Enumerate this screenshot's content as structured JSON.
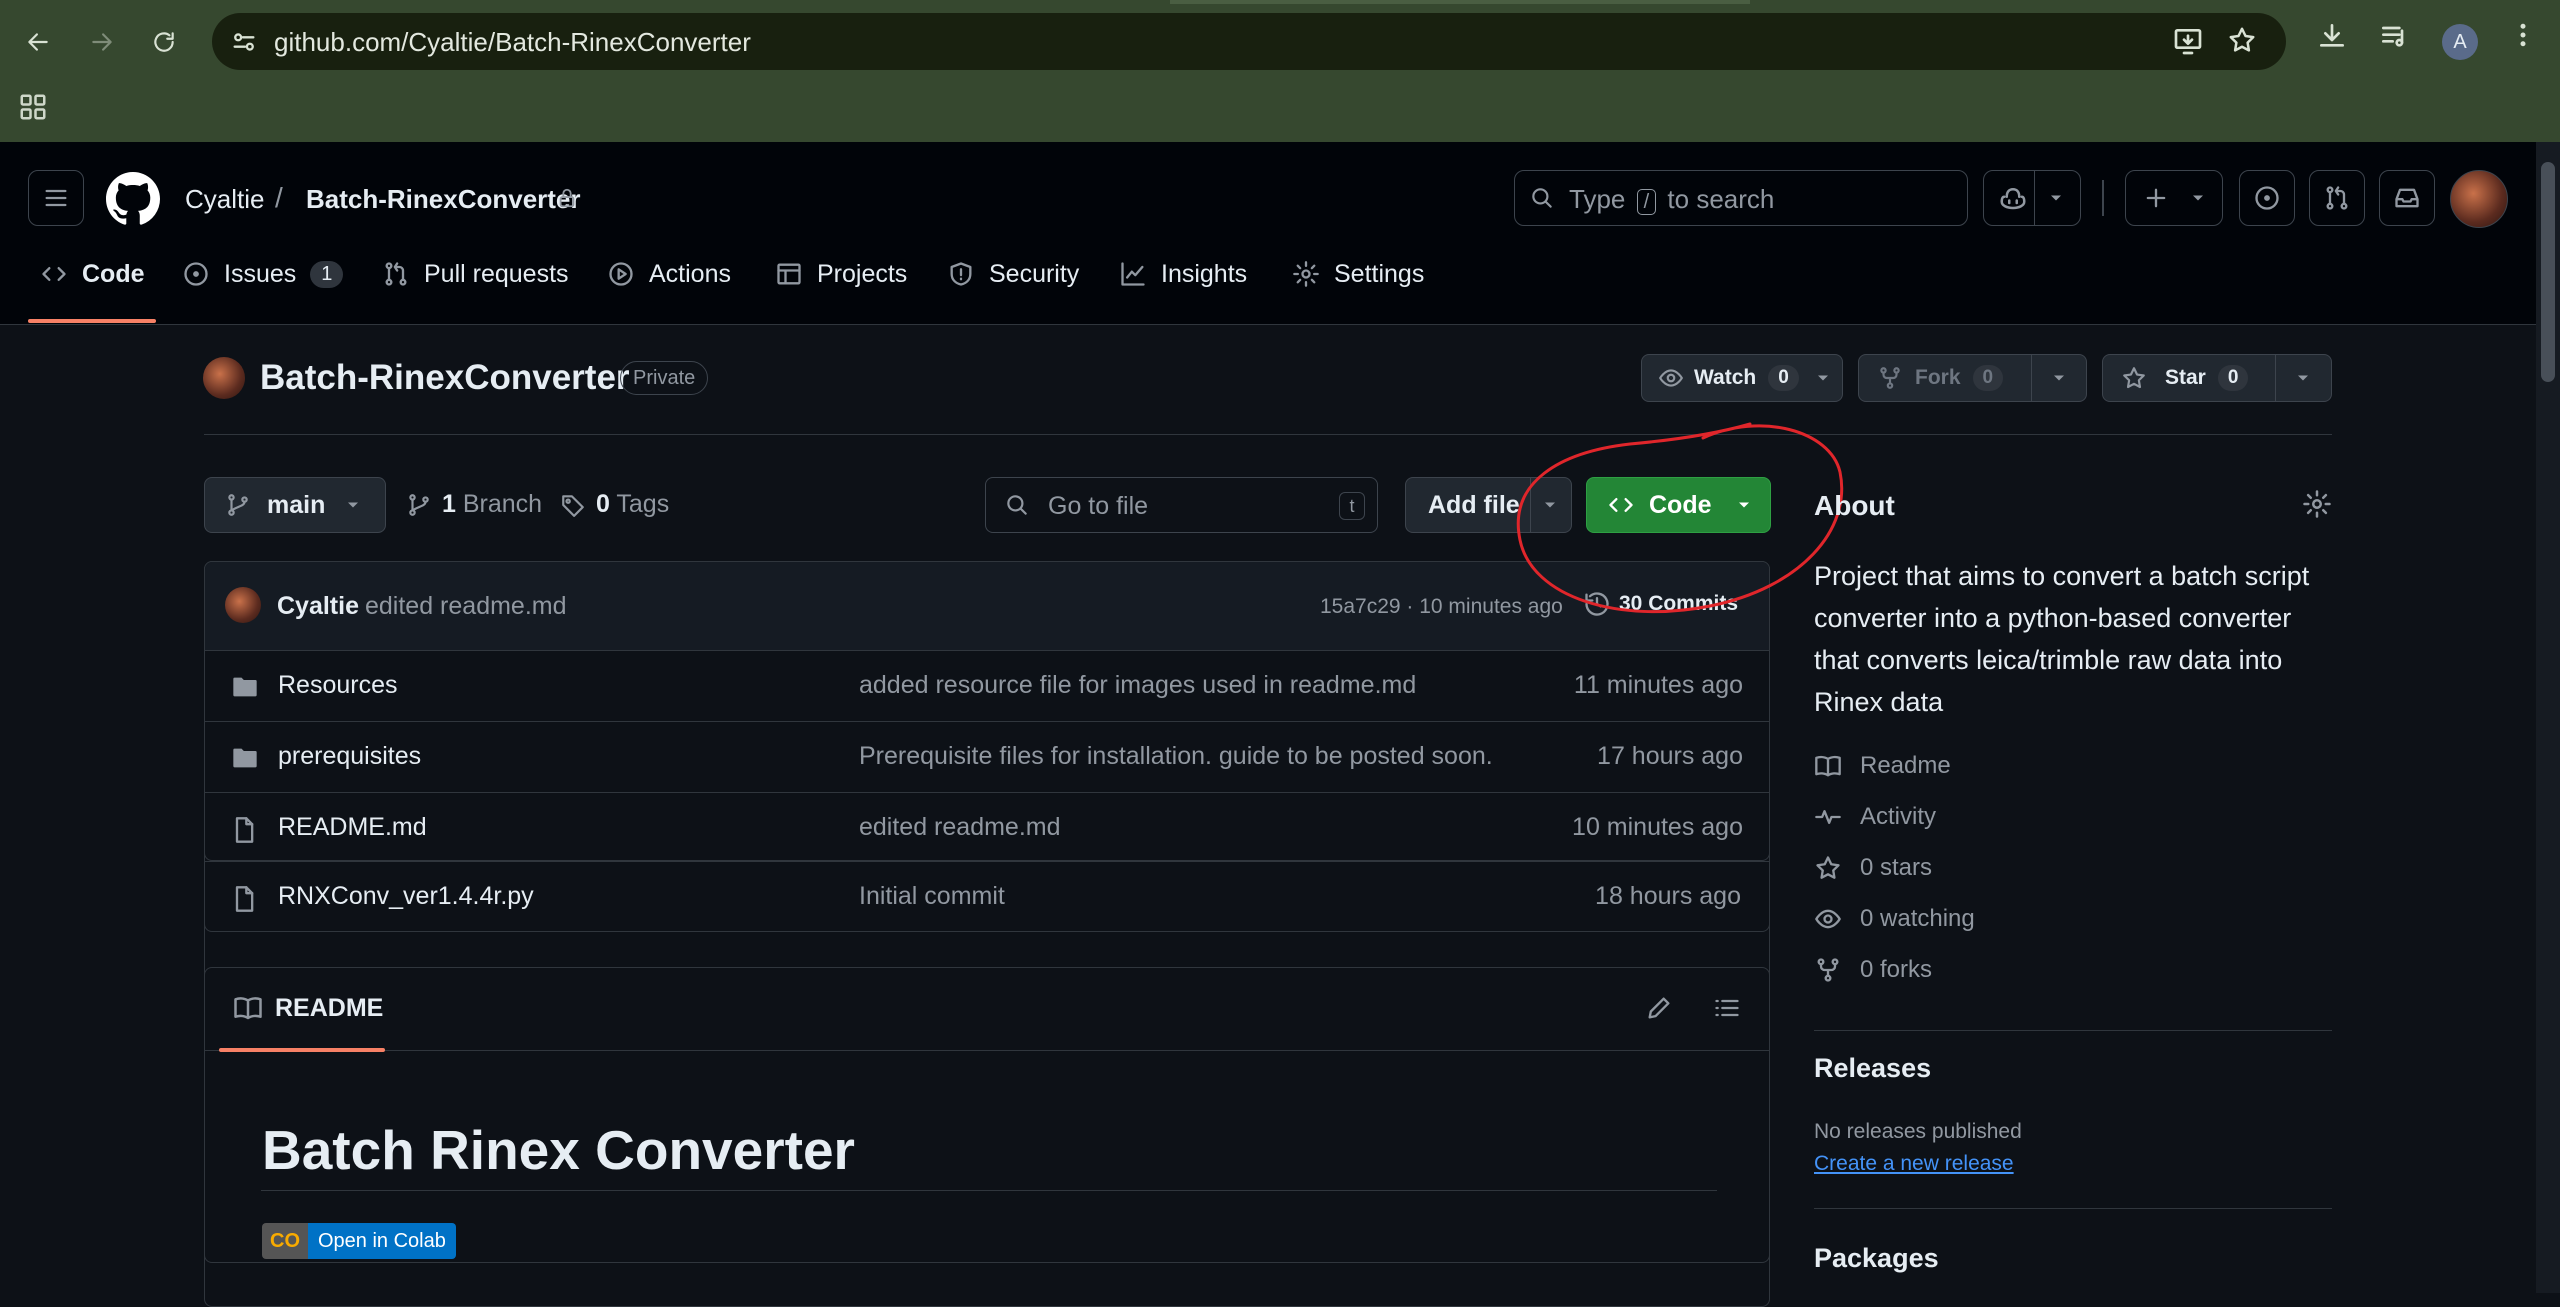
{
  "browser": {
    "url": "github.com/Cyaltie/Batch-RinexConverter",
    "profile_initial": "A"
  },
  "header": {
    "owner": "Cyaltie",
    "separator": "/",
    "repo": "Batch-RinexConverter",
    "search_pre": "Type",
    "search_key": "/",
    "search_post": "to search"
  },
  "tabs": [
    {
      "label": "Code"
    },
    {
      "label": "Issues",
      "count": "1"
    },
    {
      "label": "Pull requests"
    },
    {
      "label": "Actions"
    },
    {
      "label": "Projects"
    },
    {
      "label": "Security"
    },
    {
      "label": "Insights"
    },
    {
      "label": "Settings"
    }
  ],
  "repo": {
    "title": "Batch-RinexConverter",
    "visibility": "Private",
    "watch_label": "Watch",
    "watch_count": "0",
    "fork_label": "Fork",
    "fork_count": "0",
    "star_label": "Star",
    "star_count": "0"
  },
  "toolbar": {
    "branch": "main",
    "branches_count": "1",
    "branches_label": "Branch",
    "tags_count": "0",
    "tags_label": "Tags",
    "goto_placeholder": "Go to file",
    "goto_key": "t",
    "add_file": "Add file",
    "code": "Code"
  },
  "commit": {
    "author": "Cyaltie",
    "message": "edited readme.md",
    "hash_time": "15a7c29 · 10 minutes ago",
    "commits": "30 Commits"
  },
  "files": [
    {
      "name": "Resources",
      "type": "folder",
      "message": "added resource file for images used in readme.md",
      "time": "11 minutes ago"
    },
    {
      "name": "prerequisites",
      "type": "folder",
      "message": "Prerequisite files for installation. guide to be posted soon.",
      "time": "17 hours ago"
    },
    {
      "name": "README.md",
      "type": "file",
      "message": "edited readme.md",
      "time": "10 minutes ago"
    },
    {
      "name": "RNXConv_ver1.4.4r.py",
      "type": "file",
      "message": "Initial commit",
      "time": "18 hours ago"
    }
  ],
  "readme": {
    "tab": "README",
    "heading": "Batch Rinex Converter",
    "badge_logo": "CO",
    "badge_text": "Open in Colab"
  },
  "about": {
    "title": "About",
    "description": "Project that aims to convert a batch script converter into a python-based converter that converts leica/trimble raw data into Rinex data",
    "links": [
      "Readme",
      "Activity",
      "0 stars",
      "0 watching",
      "0 forks"
    ],
    "releases_title": "Releases",
    "releases_text": "No releases published",
    "releases_link": "Create a new release",
    "packages_title": "Packages"
  },
  "colors": {
    "chrome_bg": "#36482f",
    "page_bg": "#0d1117",
    "header_bg": "#010409",
    "accent_underline": "#f78166",
    "code_button": "#238636",
    "link": "#4493f8",
    "annotation_circle": "#e0262b"
  }
}
